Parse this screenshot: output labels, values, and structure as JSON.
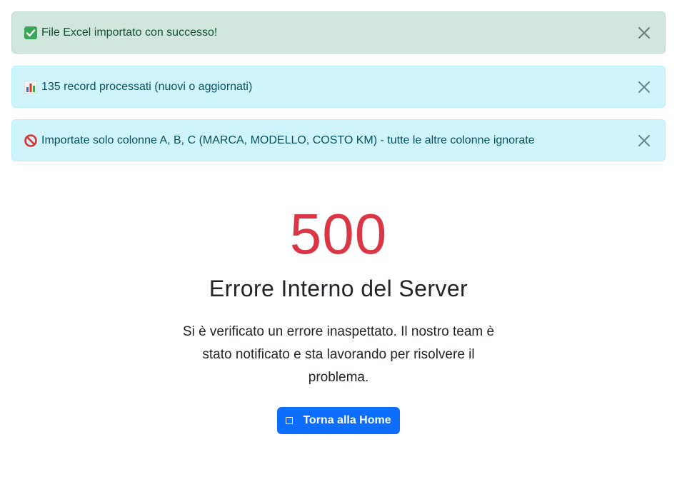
{
  "alerts": [
    {
      "type": "success",
      "icon": "check-mark-emoji-icon",
      "text": "File Excel importato con successo!"
    },
    {
      "type": "info",
      "icon": "bar-chart-emoji-icon",
      "text": "135 record processati (nuovi o aggiornati)"
    },
    {
      "type": "info",
      "icon": "prohibited-emoji-icon",
      "text": "Importate solo colonne A, B, C (MARCA, MODELLO, COSTO KM) - tutte le altre colonne ignorate"
    }
  ],
  "error": {
    "code": "500",
    "title": "Errore Interno del Server",
    "description": "Si è verificato un errore inaspettato. Il nostro team è stato notificato e sta lavorando per risolvere il problema."
  },
  "home_button": {
    "label": "Torna alla Home",
    "icon": "home-icon"
  },
  "colors": {
    "success_bg": "#d1e7dd",
    "info_bg": "#cff4fc",
    "error_code": "#dc3545",
    "primary": "#0d6efd"
  }
}
